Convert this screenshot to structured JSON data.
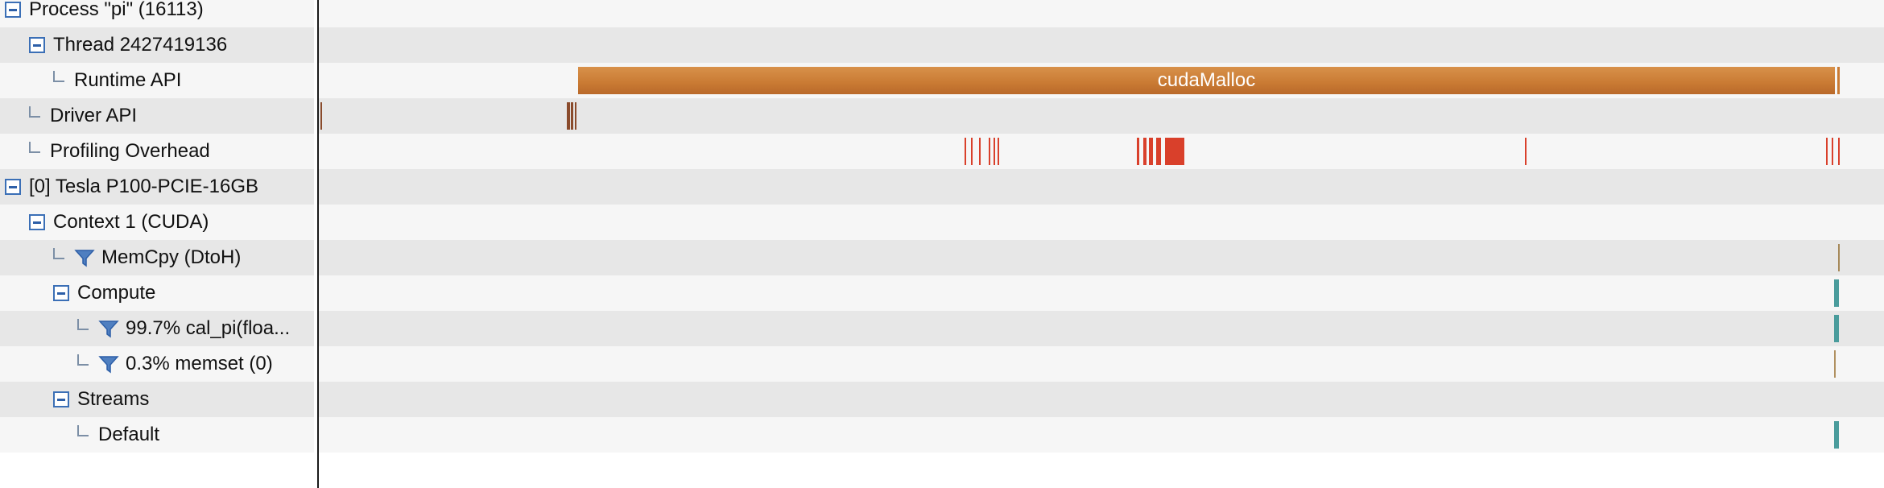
{
  "tree": {
    "rows": [
      {
        "label": "Process \"pi\" (16113)",
        "kind": "collapse"
      },
      {
        "label": "Thread 2427419136",
        "kind": "collapse"
      },
      {
        "label": "Runtime API",
        "kind": "leaf"
      },
      {
        "label": "Driver API",
        "kind": "leaf"
      },
      {
        "label": "Profiling Overhead",
        "kind": "leaf"
      },
      {
        "label": "[0] Tesla P100-PCIE-16GB",
        "kind": "collapse"
      },
      {
        "label": "Context 1 (CUDA)",
        "kind": "collapse"
      },
      {
        "label": "MemCpy (DtoH)",
        "kind": "filter"
      },
      {
        "label": "Compute",
        "kind": "collapse"
      },
      {
        "label": "99.7% cal_pi(floa...",
        "kind": "filter"
      },
      {
        "label": "0.3% memset (0)",
        "kind": "filter"
      },
      {
        "label": "Streams",
        "kind": "collapse"
      },
      {
        "label": "Default",
        "kind": "leaf"
      }
    ]
  },
  "timeline": {
    "runtime_api": {
      "label": "cudaMalloc"
    }
  },
  "colors": {
    "runtime_api": "#c97a33",
    "driver_api": "#8a4b2c",
    "profiling_overhead": "#d9402b",
    "memcpy": "#a6895a",
    "compute": "#4a9c9c",
    "memset": "#b09060",
    "collapse_border": "#3b6fb6",
    "row_light": "#f6f6f6",
    "row_dark": "#e7e7e7"
  },
  "icons": {
    "collapse": "collapse-icon",
    "leaf": "tree-connector-icon",
    "filter": "filter-icon"
  }
}
